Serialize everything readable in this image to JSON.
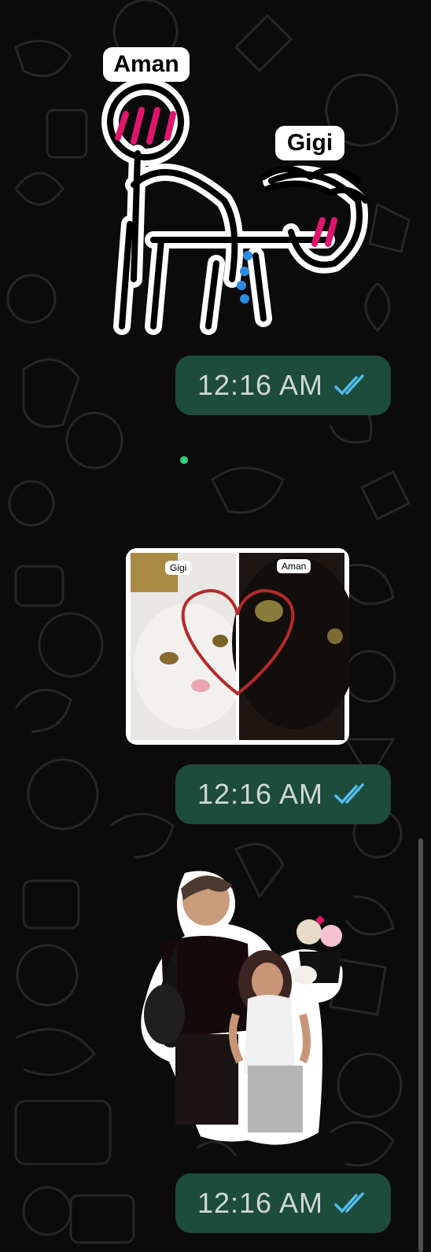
{
  "chat": {
    "messages": [
      {
        "type": "sticker",
        "description": "doodle",
        "labels": [
          "Aman",
          "Gigi"
        ],
        "time": "12:16 AM",
        "status": "read"
      },
      {
        "type": "sticker",
        "description": "cats",
        "labels": [
          "Gigi",
          "Aman"
        ],
        "time": "12:16 AM",
        "status": "read"
      },
      {
        "type": "sticker",
        "description": "couple",
        "time": "12:16 AM",
        "status": "read"
      }
    ]
  },
  "colors": {
    "background": "#0b0b0b",
    "bubble": "#1d4b3c",
    "tick": "#53bdeb",
    "online": "#35d07f"
  },
  "icons": [
    "double-check-icon"
  ]
}
